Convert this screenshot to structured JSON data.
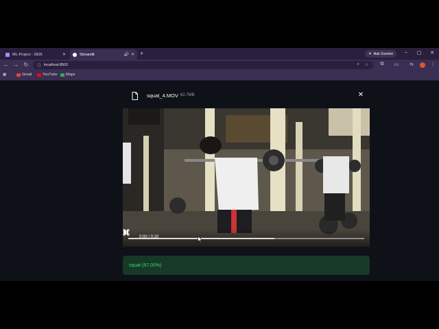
{
  "browser": {
    "tabs": [
      {
        "title": "ML-Project - 2826",
        "favicon_color": "#a78bfa"
      },
      {
        "title": "Streamlit",
        "favicon_color": "#ffffff",
        "active": true
      }
    ],
    "new_tab_symbol": "+",
    "ask_gemini_label": "Ask Gemini",
    "window_controls": {
      "minimize": "–",
      "maximize": "▢",
      "close": "✕"
    },
    "url": "localhost:8501",
    "bookmarks": [
      {
        "label": "Gmail",
        "color": "#ea4335"
      },
      {
        "label": "YouTube",
        "color": "#ff0000"
      },
      {
        "label": "Maps",
        "color": "#34a853"
      }
    ]
  },
  "dialog": {
    "file_name": "squat_4.MOV",
    "file_size": "62.7MB",
    "close_symbol": "✕",
    "video": {
      "time": "0:00 / 0:20",
      "progress": 0.0,
      "buffered": 0.62
    },
    "result": "squat (67.00%)"
  },
  "colors": {
    "page_bg": "#0e1117",
    "result_bg": "#173928",
    "result_text": "#3dd56d",
    "tab_strip": "#2b1f3e",
    "toolbar": "#3a2e52"
  }
}
